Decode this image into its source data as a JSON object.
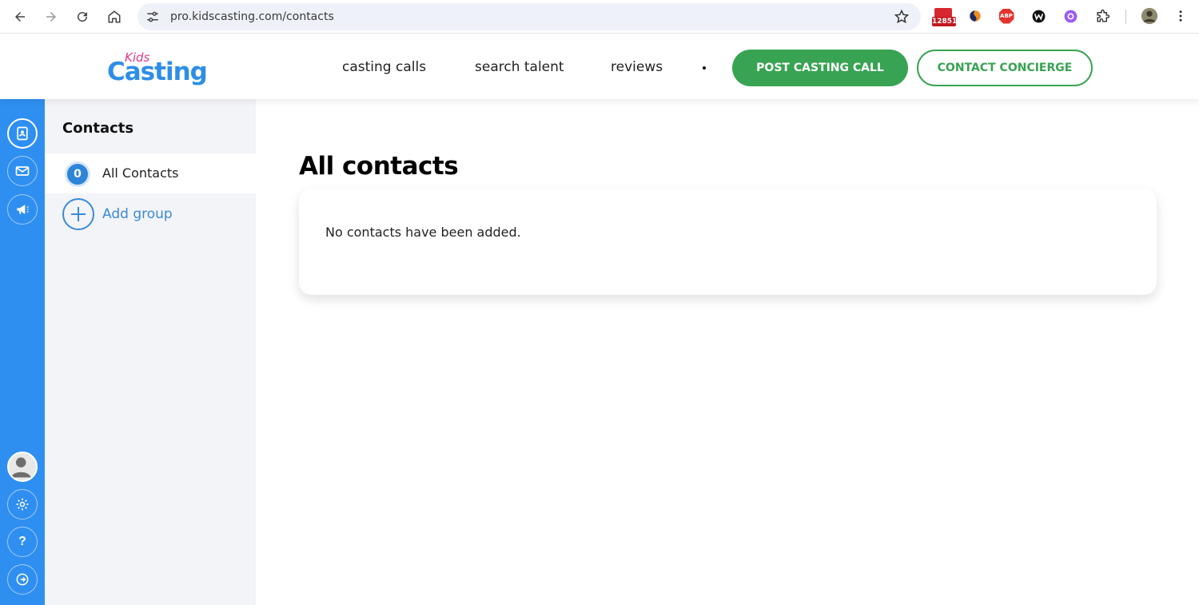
{
  "browser": {
    "url": "pro.kidscasting.com/contacts",
    "gmail_count": "12851",
    "abp_label": "ABP"
  },
  "header": {
    "logo_kids": "Kids",
    "logo_casting": "Casting",
    "nav": [
      "casting calls",
      "search talent",
      "reviews"
    ],
    "post_button": "POST CASTING CALL",
    "concierge_button": "CONTACT CONCIERGE"
  },
  "rail": {
    "help_label": "?"
  },
  "sidebar": {
    "title": "Contacts",
    "all_contacts": {
      "count": "0",
      "label": "All Contacts"
    },
    "add_group_label": "Add group"
  },
  "main": {
    "title": "All contacts",
    "empty_message": "No contacts have been added."
  },
  "colors": {
    "brand_blue": "#2f8ff0",
    "brand_green": "#38a352",
    "logo_pink": "#e0388c"
  }
}
